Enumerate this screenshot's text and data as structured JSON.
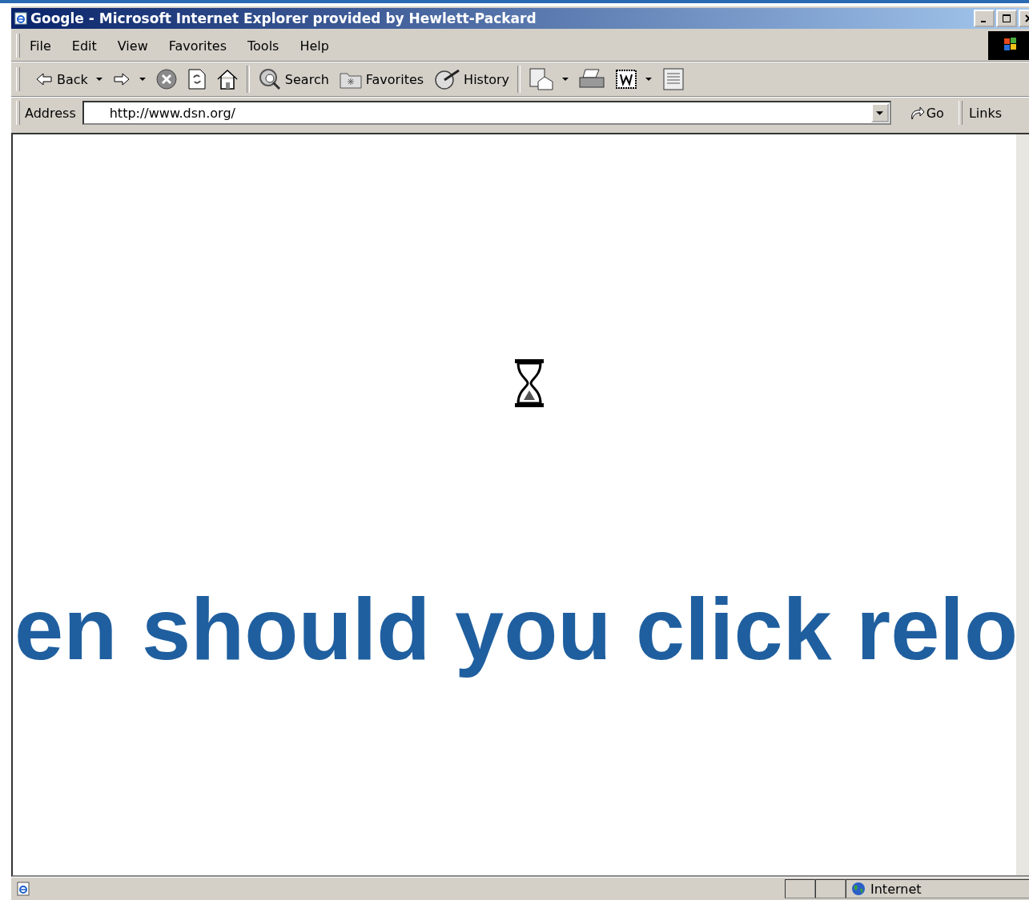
{
  "window": {
    "title": "Google - Microsoft Internet Explorer provided by Hewlett-Packard"
  },
  "menu": [
    "File",
    "Edit",
    "View",
    "Favorites",
    "Tools",
    "Help"
  ],
  "toolbar": [
    {
      "kind": "back",
      "label": "Back"
    },
    {
      "kind": "forward"
    },
    {
      "kind": "stop"
    },
    {
      "kind": "refresh"
    },
    {
      "kind": "home"
    },
    {
      "kind": "search",
      "label": "Search"
    },
    {
      "kind": "favorites",
      "label": "Favorites"
    },
    {
      "kind": "history",
      "label": "History"
    },
    {
      "kind": "mail"
    },
    {
      "kind": "print"
    },
    {
      "kind": "edit"
    },
    {
      "kind": "discuss"
    }
  ],
  "address": {
    "label": "Address",
    "value": "http://www.dsn.org/",
    "go": "Go",
    "links": "Links"
  },
  "overlay_text": "en should you click relo",
  "status_bar": {
    "zone": "Internet"
  }
}
